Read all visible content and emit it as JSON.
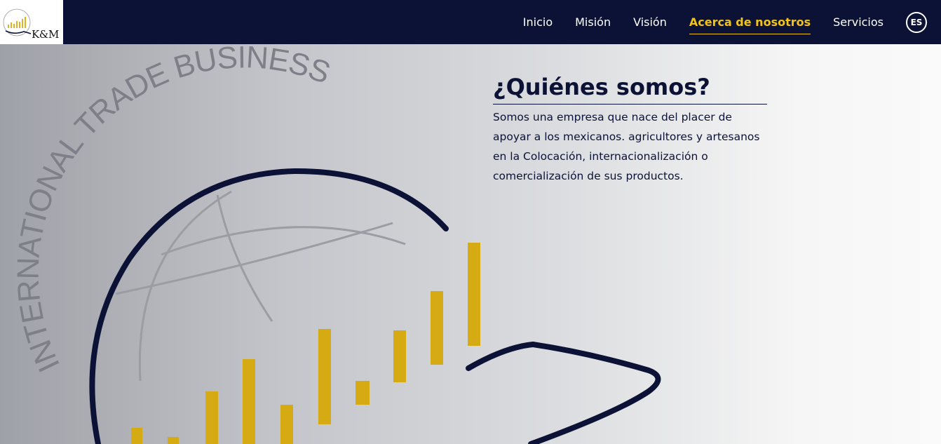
{
  "logo": {
    "text": "K&M",
    "colors": {
      "bars": "#e0b21a",
      "swoosh": "#0c1236"
    }
  },
  "nav": {
    "items": [
      {
        "label": "Inicio",
        "active": false
      },
      {
        "label": "Misión",
        "active": false
      },
      {
        "label": "Visión",
        "active": false
      },
      {
        "label": "Acerca de nosotros",
        "active": true
      },
      {
        "label": "Servicios",
        "active": false
      }
    ],
    "language": "ES"
  },
  "hero": {
    "emblem_text": "INTERNATIONAL TRADE BUSINESS",
    "colors": {
      "navy": "#0c1236",
      "gold": "#d6aa12",
      "grey": "#999aa3"
    }
  },
  "about": {
    "title": "¿Quiénes somos?",
    "body": "Somos una empresa que nace del placer de apoyar a los mexicanos. agricultores y artesanos en la Colocación, internacionalización o comercialización de sus productos."
  },
  "colors": {
    "nav_bg": "#0c1236",
    "accent": "#f2c318",
    "text": "#0c1236"
  }
}
